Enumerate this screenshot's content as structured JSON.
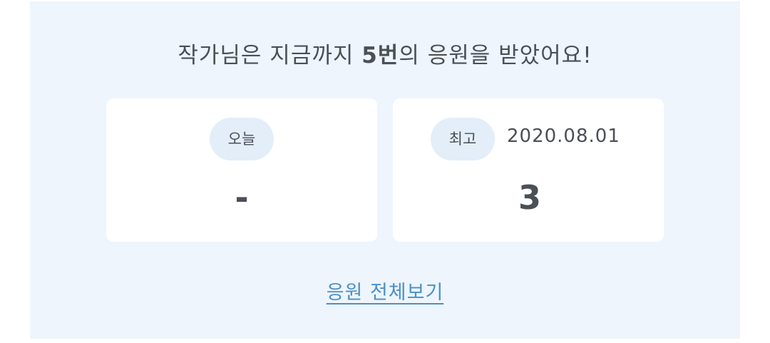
{
  "headline": {
    "prefix": "작가님은 지금까지 ",
    "count": "5번",
    "suffix": "의 응원을 받았어요!"
  },
  "today_card": {
    "label": "오늘",
    "value": "-"
  },
  "best_card": {
    "label": "최고",
    "date": "2020.08.01",
    "value": "3"
  },
  "view_all_link": "응원 전체보기",
  "colors": {
    "panel_background": "#eef5fc",
    "pill_background": "#e3eef9",
    "text": "#4b4f56",
    "link": "#4a90c9"
  }
}
